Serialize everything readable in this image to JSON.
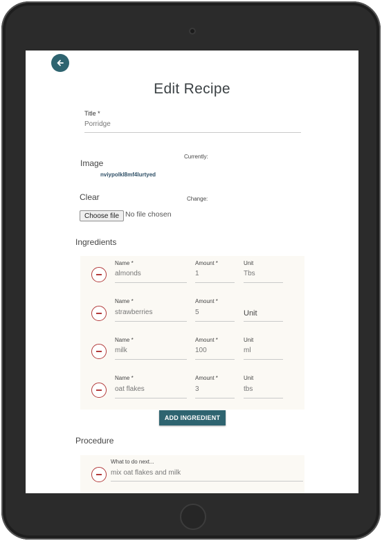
{
  "page": {
    "title": "Edit Recipe"
  },
  "back_icon": "arrow-left-icon",
  "title_field": {
    "label": "Title *",
    "value": "Porridge"
  },
  "image_field": {
    "label": "Image",
    "currently_label": "Currently:",
    "current_file": "nviypolkl8mf4lurtyed",
    "clear_label": "Clear",
    "change_label": "Change:",
    "choose_button": "Choose file",
    "no_file_text": "No file chosen"
  },
  "ingredients": {
    "heading": "Ingredients",
    "name_label": "Name *",
    "amount_label": "Amount *",
    "unit_label": "Unit",
    "rows": [
      {
        "name": "almonds",
        "amount": "1",
        "unit": "Tbs"
      },
      {
        "name": "strawberries",
        "amount": "5",
        "unit": "Unit"
      },
      {
        "name": "milk",
        "amount": "100",
        "unit": "ml"
      },
      {
        "name": "oat flakes",
        "amount": "3",
        "unit": "tbs"
      }
    ],
    "add_button": "ADD INGREDIENT"
  },
  "procedure": {
    "heading": "Procedure",
    "step_label": "What to do next...",
    "steps": [
      {
        "text": "mix oat flakes and milk"
      }
    ]
  },
  "colors": {
    "accent": "#2e6470",
    "remove": "#b23a3a",
    "panel": "#fbf9f4"
  }
}
